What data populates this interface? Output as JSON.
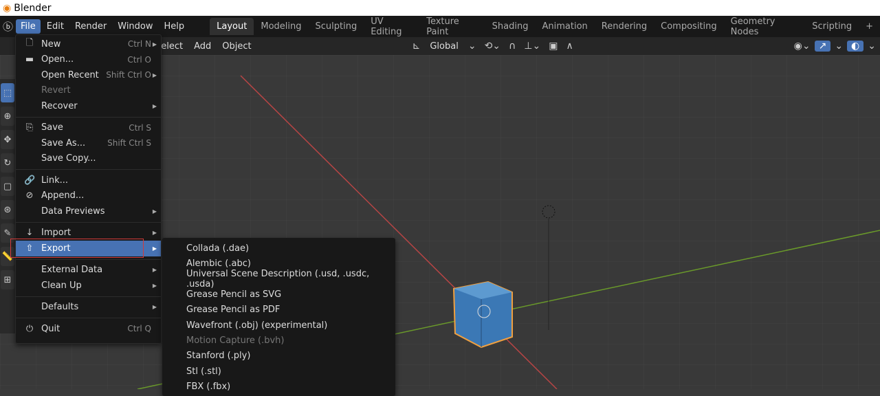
{
  "window": {
    "title": "Blender"
  },
  "topmenu": [
    "File",
    "Edit",
    "Render",
    "Window",
    "Help"
  ],
  "workspaces": [
    "Layout",
    "Modeling",
    "Sculpting",
    "UV Editing",
    "Texture Paint",
    "Shading",
    "Animation",
    "Rendering",
    "Compositing",
    "Geometry Nodes",
    "Scripting",
    "+"
  ],
  "header": {
    "select": "Select",
    "add": "Add",
    "object": "Object",
    "orientation": "Global"
  },
  "file_menu": [
    {
      "label": "New",
      "shortcut": "Ctrl N",
      "icon": "new-file",
      "arrow": true
    },
    {
      "label": "Open...",
      "shortcut": "Ctrl O",
      "icon": "folder"
    },
    {
      "label": "Open Recent",
      "shortcut": "Shift Ctrl O",
      "arrow": true
    },
    {
      "label": "Revert",
      "disabled": true
    },
    {
      "label": "Recover",
      "arrow": true
    },
    {
      "label": "Save",
      "shortcut": "Ctrl S",
      "icon": "save"
    },
    {
      "label": "Save As...",
      "shortcut": "Shift Ctrl S"
    },
    {
      "label": "Save Copy..."
    },
    {
      "label": "Link...",
      "icon": "link"
    },
    {
      "label": "Append...",
      "icon": "append"
    },
    {
      "label": "Data Previews",
      "arrow": true
    },
    {
      "label": "Import",
      "icon": "import",
      "arrow": true
    },
    {
      "label": "Export",
      "icon": "export",
      "arrow": true,
      "highlighted": true
    },
    {
      "label": "External Data",
      "arrow": true
    },
    {
      "label": "Clean Up",
      "arrow": true
    },
    {
      "label": "Defaults",
      "arrow": true
    },
    {
      "label": "Quit",
      "shortcut": "Ctrl Q",
      "icon": "power"
    }
  ],
  "export_menu": [
    "Collada (.dae)",
    "Alembic (.abc)",
    "Universal Scene Description (.usd, .usdc, .usda)",
    "Grease Pencil as SVG",
    "Grease Pencil as PDF",
    "Wavefront (.obj) (experimental)",
    "Motion Capture (.bvh)",
    "Stanford (.ply)",
    "Stl (.stl)",
    "FBX (.fbx)"
  ],
  "colors": {
    "accent": "#4772b3",
    "highlight_box": "#d23b3b",
    "x_axis": "#b84545",
    "y_axis": "#6a9a2a"
  }
}
